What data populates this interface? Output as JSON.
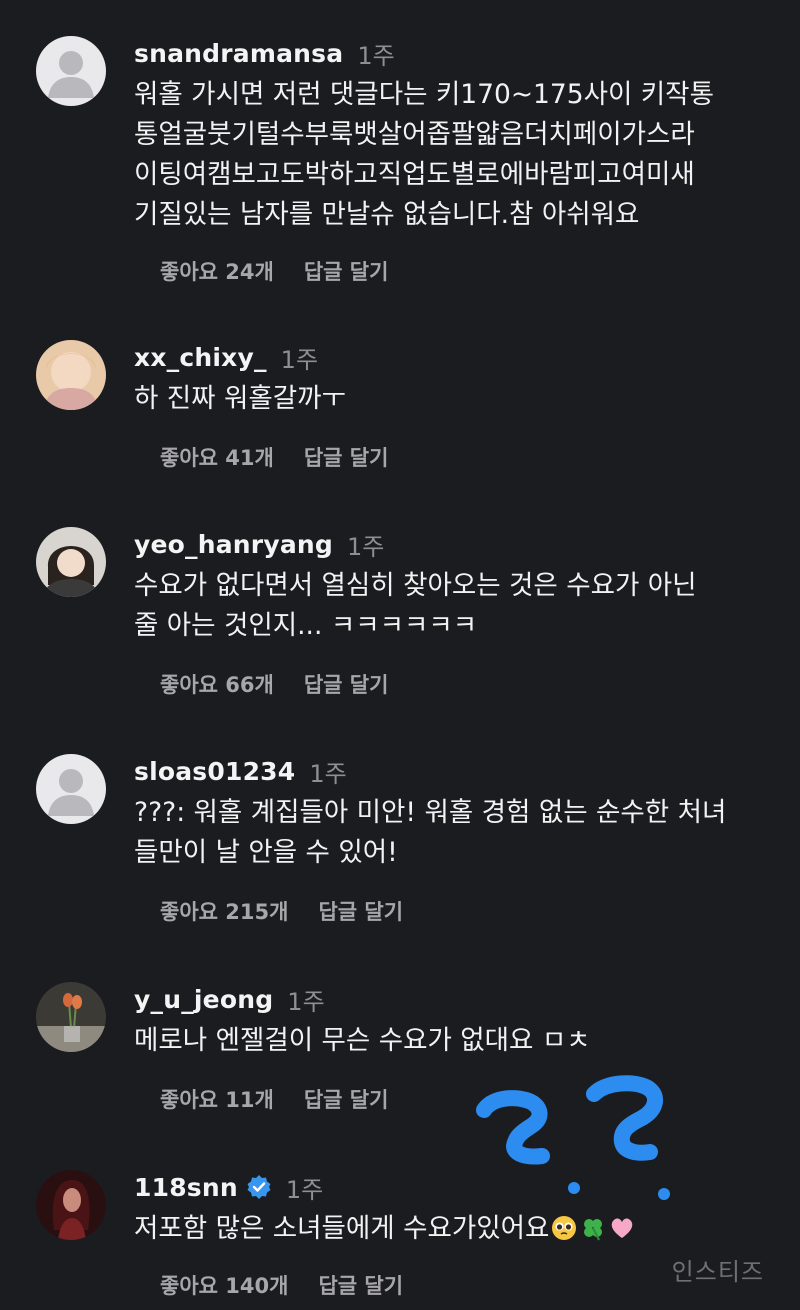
{
  "comments": [
    {
      "username": "snandramansa",
      "time": "1주",
      "text": "워홀 가시면 저런 댓글다는 키170~175사이 키작통\n통얼굴붓기털수부룩뱃살어좁팔얇음더치페이가스라\n이팅여캠보고도박하고직업도별로에바람피고여미새\n기질있는 남자를 만날슈 없습니다.참 아쉬워요",
      "likes": "좋아요 24개",
      "reply": "답글 달기"
    },
    {
      "username": "xx_chixy_",
      "time": "1주",
      "text": "하 진짜 워홀갈까ㅜ",
      "likes": "좋아요 41개",
      "reply": "답글 달기"
    },
    {
      "username": "yeo_hanryang",
      "time": "1주",
      "text": "수요가 없다면서 열심히 찾아오는 것은 수요가 아닌\n줄 아는 것인지... ㅋㅋㅋㅋㅋㅋ",
      "likes": "좋아요 66개",
      "reply": "답글 달기"
    },
    {
      "username": "sloas01234",
      "time": "1주",
      "text": "???: 워홀 계집들아 미안! 워홀 경험 없는 순수한 처녀\n들만이 날 안을 수 있어!",
      "likes": "좋아요 215개",
      "reply": "답글 달기"
    },
    {
      "username": "y_u_jeong",
      "time": "1주",
      "text": "메로나 엔젤걸이 무슨 수요가 없대요 ㅁㅊ",
      "likes": "좋아요 11개",
      "reply": "답글 달기"
    },
    {
      "username": "118snn",
      "time": "1주",
      "text": "저포함 많은 소녀들에게 수요가있어요",
      "likes": "좋아요 140개",
      "reply": "답글 달기",
      "verified": true,
      "emojis": [
        "pleading-face-icon",
        "four-leaf-clover-icon",
        "pink-heart-icon"
      ]
    }
  ],
  "watermark": "인스티즈",
  "colors": {
    "background": "#1b1c20",
    "text": "#f2f2f2",
    "muted": "#8e8e93",
    "verified": "#3797f0",
    "doodle": "#2d8cf0"
  }
}
